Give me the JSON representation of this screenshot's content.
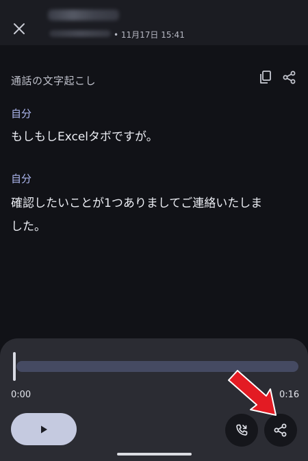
{
  "header": {
    "call_datetime": "• 11月17日 15:41"
  },
  "transcript": {
    "title": "通話の文字起こし",
    "entries": [
      {
        "speaker": "自分",
        "lines": [
          "もしもしExcelタボですが。"
        ]
      },
      {
        "speaker": "自分",
        "lines": [
          "確認したいことが1つありましてご連絡いたしま",
          "した。"
        ]
      }
    ]
  },
  "player": {
    "time_start": "0:00",
    "time_end": "0:16",
    "progress": 0.0
  },
  "icons": {
    "close": "close-icon",
    "copy": "copy-icon",
    "share": "share-icon",
    "play": "play-icon",
    "call": "phone-call-icon",
    "arrow": "red-arrow-annotation"
  },
  "colors": {
    "background": "#111217",
    "header": "#1b1c22",
    "player": "#2b2c33",
    "speaker_accent": "#aeb8f0",
    "play_button": "#c5cae0",
    "track": "#454a62",
    "annotation_arrow": "#e31b23"
  }
}
